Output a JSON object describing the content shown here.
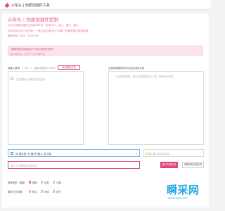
{
  "header": {
    "title": "火车头 | 伪原创插件工具"
  },
  "hero": {
    "title": "火车头 | 伪原创插件定制",
    "lines": [
      "火车头伪原创插件支持各种平台：支持GPT、文心、通义、星火",
      "支持自动生成一段文案，一段生成文案(自行)文案一段使用插件直接使用",
      "需求定制 | V/Q：3285164"
    ]
  },
  "notice": {
    "main": "非偶尔相关使用指示代码文案进行提示",
    "sub": "输入要点后，点击下方出对要发布"
  },
  "left": {
    "label": "请输入要求",
    "hint": "（一段一个，最多不超过5000字，在此输入你的内容）",
    "add_button": "添加随机文案",
    "checkbox_text": "在这里输入标题生成的文案"
  },
  "right": {
    "label": "这里将根据所填写内容生成的文案",
    "placeholder": "生成的结果将，每行生成结果会不一样！等待执行测试"
  },
  "keyword": {
    "value": "AI_被生成_写_随_时 输入_这 内容"
  },
  "right_input": {
    "placeholder": "输入嵌入的内容以后"
  },
  "article": {
    "placeholder": "输入个人想写的以后内容"
  },
  "buttons": {
    "generate": "进行内容生成",
    "reset": "重置所有内容生成"
  },
  "range": {
    "label": "推荐类型（调整）",
    "options": [
      "通用",
      "创意",
      "平衡"
    ],
    "selected": "通用"
  },
  "options": {
    "label": "输出方式设置",
    "items": [
      "默认",
      "优化",
      "改写"
    ]
  },
  "watermark": {
    "text": "瞬采网",
    "sub": "www.xxx.com"
  }
}
